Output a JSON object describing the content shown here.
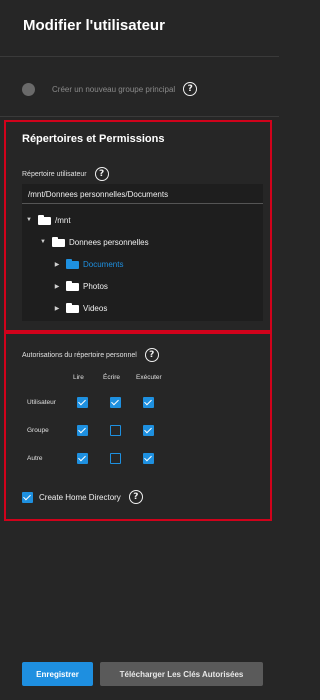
{
  "page": {
    "title": "Modifier l'utilisateur"
  },
  "new_group_toggle": {
    "label": "Créer un nouveau groupe principal",
    "enabled": false,
    "help_icon": "question-circle-icon"
  },
  "directories_section": {
    "title": "Répertoires et Permissions",
    "home_dir_label": "Répertoire utilisateur",
    "home_dir_value": "/mnt/Donnees personnelles/Documents",
    "tree": [
      {
        "label": "/mnt",
        "expanded": true,
        "icon": "folder-icon"
      },
      {
        "label": "Donnees personnelles",
        "expanded": true,
        "icon": "folder-icon"
      },
      {
        "label": "Documents",
        "expanded": false,
        "selected": true,
        "icon": "folder-icon"
      },
      {
        "label": "Photos",
        "expanded": false,
        "icon": "folder-icon"
      },
      {
        "label": "Videos",
        "expanded": false,
        "icon": "folder-icon"
      }
    ]
  },
  "permissions_section": {
    "title": "Autorisations du répertoire personnel",
    "columns": [
      "Lire",
      "Écrire",
      "Exécuter"
    ],
    "rows": [
      {
        "label": "Utilisateur",
        "values": [
          true,
          true,
          true
        ]
      },
      {
        "label": "Groupe",
        "values": [
          true,
          false,
          true
        ]
      },
      {
        "label": "Autre",
        "values": [
          true,
          false,
          true
        ]
      }
    ],
    "create_home": {
      "label": "Create Home Directory",
      "checked": true
    }
  },
  "actions": {
    "save_label": "Enregistrer",
    "download_keys_label": "Télécharger Les Clés Autorisées"
  },
  "colors": {
    "accent": "#1e90e0",
    "highlight_border": "#d0021b",
    "background": "#262626"
  }
}
